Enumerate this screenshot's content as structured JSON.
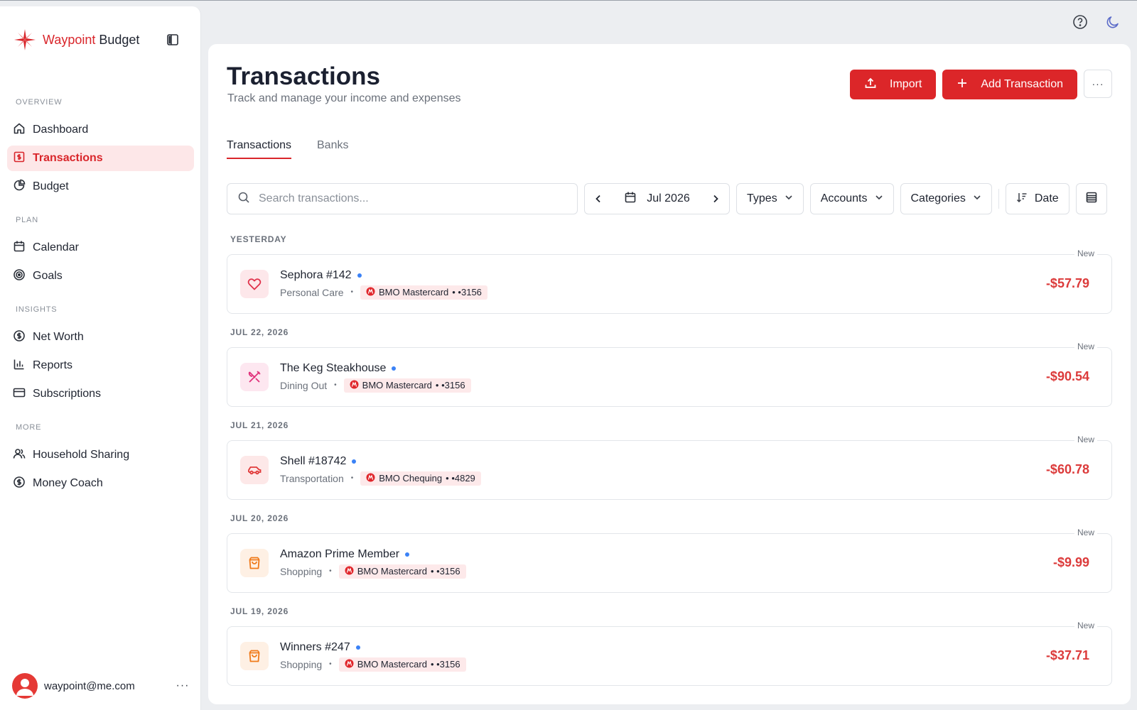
{
  "brand": {
    "name_part1": "Waypoint",
    "name_part2": " Budget"
  },
  "sidebar": {
    "sections": [
      {
        "title": "OVERVIEW",
        "items": [
          {
            "label": "Dashboard",
            "icon": "home-icon"
          },
          {
            "label": "Transactions",
            "icon": "receipt-icon",
            "active": true
          },
          {
            "label": "Budget",
            "icon": "pie-chart-icon"
          }
        ]
      },
      {
        "title": "PLAN",
        "items": [
          {
            "label": "Calendar",
            "icon": "calendar-icon"
          },
          {
            "label": "Goals",
            "icon": "target-icon"
          }
        ]
      },
      {
        "title": "INSIGHTS",
        "items": [
          {
            "label": "Net Worth",
            "icon": "dollar-circle-icon"
          },
          {
            "label": "Reports",
            "icon": "bar-chart-icon"
          },
          {
            "label": "Subscriptions",
            "icon": "credit-card-icon"
          }
        ]
      },
      {
        "title": "MORE",
        "items": [
          {
            "label": "Household Sharing",
            "icon": "users-icon"
          },
          {
            "label": "Money Coach",
            "icon": "coin-icon"
          }
        ]
      }
    ]
  },
  "user": {
    "email": "waypoint@me.com",
    "more": "···"
  },
  "header": {
    "title": "Transactions",
    "subtitle": "Track and manage your income and expenses",
    "import_label": "Import",
    "add_label": "Add Transaction",
    "more": "···"
  },
  "tabs": [
    {
      "label": "Transactions",
      "active": true
    },
    {
      "label": "Banks",
      "active": false
    }
  ],
  "filters": {
    "search_placeholder": "Search transactions...",
    "month": "Jul 2026",
    "types": "Types",
    "accounts": "Accounts",
    "categories": "Categories",
    "sort": "Date"
  },
  "groups": [
    {
      "date": "YESTERDAY",
      "txns": [
        {
          "merchant": "Sephora #142",
          "category": "Personal Care",
          "account": "BMO Mastercard",
          "mask": "• •3156",
          "amount": "-$57.79",
          "badge": "New",
          "icon": "heart-icon",
          "icon_color": "#e0304a",
          "icon_bg": "#fde7ea"
        }
      ]
    },
    {
      "date": "JUL 22, 2026",
      "txns": [
        {
          "merchant": "The Keg Steakhouse",
          "category": "Dining Out",
          "account": "BMO Mastercard",
          "mask": "• •3156",
          "amount": "-$90.54",
          "badge": "New",
          "icon": "utensils-icon",
          "icon_color": "#e0307a",
          "icon_bg": "#fde7f0"
        }
      ]
    },
    {
      "date": "JUL 21, 2026",
      "txns": [
        {
          "merchant": "Shell #18742",
          "category": "Transportation",
          "account": "BMO Chequing",
          "mask": "• •4829",
          "amount": "-$60.78",
          "badge": "New",
          "icon": "car-icon",
          "icon_color": "#e03a3a",
          "icon_bg": "#fde8e8"
        }
      ]
    },
    {
      "date": "JUL 20, 2026",
      "txns": [
        {
          "merchant": "Amazon Prime Member",
          "category": "Shopping",
          "account": "BMO Mastercard",
          "mask": "• •3156",
          "amount": "-$9.99",
          "badge": "New",
          "icon": "shopping-bag-icon",
          "icon_color": "#f07a1a",
          "icon_bg": "#fef0e4"
        }
      ]
    },
    {
      "date": "JUL 19, 2026",
      "txns": [
        {
          "merchant": "Winners #247",
          "category": "Shopping",
          "account": "BMO Mastercard",
          "mask": "• •3156",
          "amount": "-$37.71",
          "badge": "New",
          "icon": "shopping-bag-icon",
          "icon_color": "#f07a1a",
          "icon_bg": "#fef0e4"
        }
      ]
    }
  ],
  "colors": {
    "accent": "#d9262b",
    "amount": "#dc3b3b",
    "unread_dot": "#3b82f6",
    "chip_bg": "#fde9ea"
  }
}
